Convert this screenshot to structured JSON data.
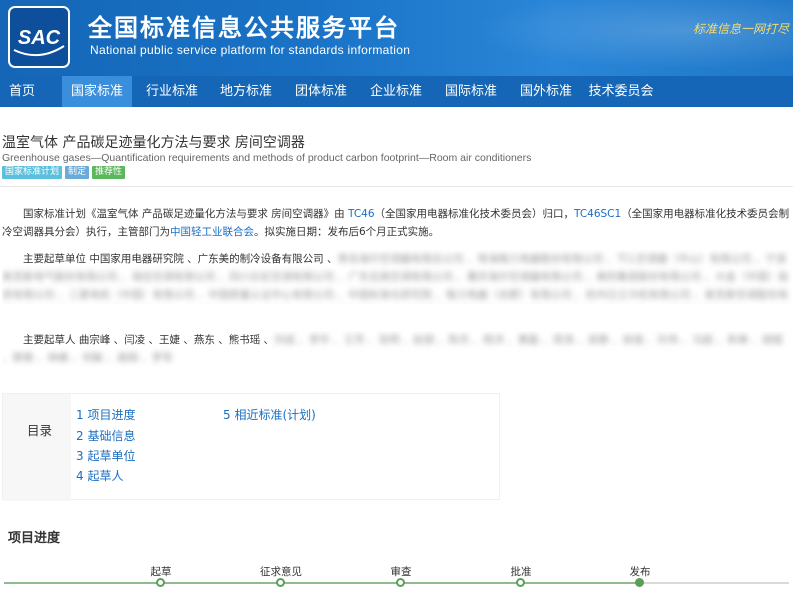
{
  "header": {
    "logo_text": "SAC",
    "title": "全国标准信息公共服务平台",
    "subtitle": "National public service platform  for standards information",
    "slogan": "标准信息一网打尽"
  },
  "nav": {
    "items": [
      {
        "label": "首页"
      },
      {
        "label": "国家标准"
      },
      {
        "label": "行业标准"
      },
      {
        "label": "地方标准"
      },
      {
        "label": "团体标准"
      },
      {
        "label": "企业标准"
      },
      {
        "label": "国际标准"
      },
      {
        "label": "国外标准"
      },
      {
        "label": "技术委员会"
      }
    ],
    "active_index": 1
  },
  "standard": {
    "title": "温室气体 产品碳足迹量化方法与要求 房间空调器",
    "title_en": "Greenhouse gases—Quantification requirements and methods of product carbon footprint—Room air conditioners",
    "badges": [
      "国家标准计划",
      "制定",
      "推荐性"
    ]
  },
  "description": {
    "p1_a": "国家标准计划《温室气体 产品碳足迹量化方法与要求 房间空调器》由 ",
    "tc_link": "TC46",
    "p1_b": "（全国家用电器标准化技术委员会）归口，",
    "sc_link": "TC46SC1",
    "p1_c": "（全国家用电器标准化技术委员会制冷空调器具分会）执行，主管部门为",
    "dept_link": "中国轻工业联合会",
    "p1_d": "。拟实施日期：发布后6个月正式实施。",
    "drafting_units_label": "主要起草单位",
    "drafting_units_visible": "中国家用电器研究院 、广东美的制冷设备有限公司 、",
    "drafting_units_blurred": "青岛海尔空调器有限总公司 、珠海格力电器股份有限公司 、TCL空调器（中山）有限公司 、宁波奥克斯电气股份有限公司 、海信空调有限公司 、四川长虹空调有限公司 、广东志高空调有限公司 、重庆海尔空调器有限公司 、美的集团股份有限公司 、大金（中国）投资有限公司 、三菱电机（中国）有限公司 、中国质量认证中心有限公司 、中国标准化研究院 、格力电器（合肥）有限公司 、杭州日立冷机有限公司 、奥克斯空调股份有限公司 、松下电器（中国）有限公司 、日立环球生活方式产品（上海）有限公司 、长虹美菱股份有限公司 、奥特朗电器（广州）有限公司 、中国家用电器协会 、佛山市顺德区美的电器有限公司 、合肥美的暖通设备有限公司 、北京工商大学",
    "drafters_label": "主要起草人",
    "drafters_visible": "曲宗峰 、闫凌 、王婕 、燕东 、熊书瑶 、",
    "drafters_blurred": "刘成 、李华 、王芳 、张明 、赵丽 、陈杰 、杨洋 、黄磊 、周涛 、吴静 、徐强 、孙伟 、马超 、朱琳 、胡斌 、郭艳 、林峰 、何敏 、高翔 、罗军"
  },
  "toc": {
    "label": "目录",
    "items": [
      "1  项目进度",
      "2  基础信息",
      "3  起草单位",
      "4  起草人",
      "5  相近标准(计划)"
    ]
  },
  "progress": {
    "title": "项目进度",
    "stages": [
      {
        "label": "起草",
        "done": false
      },
      {
        "label": "征求意见",
        "done": false
      },
      {
        "label": "审查",
        "done": false
      },
      {
        "label": "批准",
        "done": false
      },
      {
        "label": "发布",
        "done": true
      }
    ]
  }
}
